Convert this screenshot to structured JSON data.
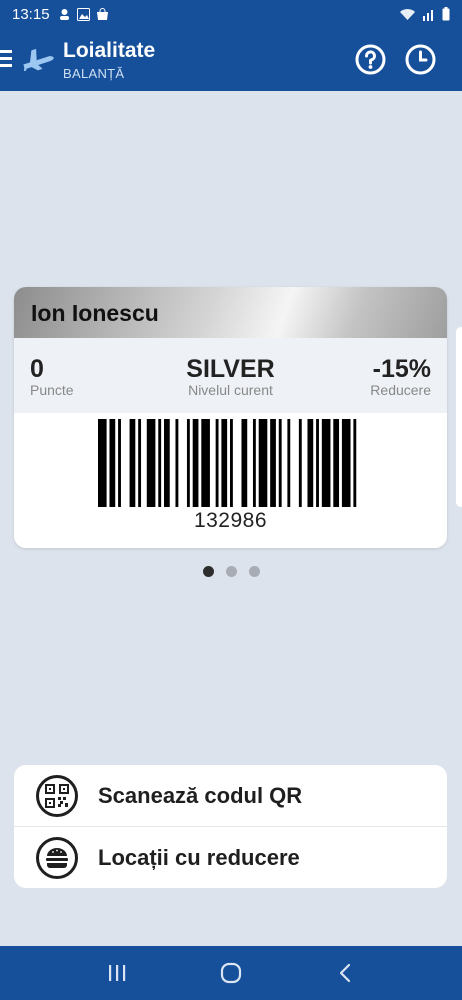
{
  "status_bar": {
    "time": "13:15"
  },
  "app_bar": {
    "title": "Loialitate",
    "subtitle": "BALANȚĂ",
    "icons": [
      "menu-icon",
      "plane-icon",
      "help-icon",
      "history-icon"
    ]
  },
  "card": {
    "holder": "Ion Ionescu",
    "points_value": "0",
    "points_label": "Puncte",
    "level_value": "SILVER",
    "level_label": "Nivelul curent",
    "discount_value": "-15%",
    "discount_label": "Reducere",
    "barcode_number": "132986"
  },
  "pager": {
    "count": 3,
    "active": 0
  },
  "actions": [
    {
      "label": "Scanează codul QR",
      "icon": "qr-code-icon"
    },
    {
      "label": "Locații cu reducere",
      "icon": "burger-icon"
    }
  ],
  "nav": {
    "icons": [
      "recent-apps-icon",
      "home-icon",
      "back-icon"
    ]
  },
  "colors": {
    "primary": "#164f9a",
    "background": "#dde3ec",
    "card_stats_bg": "#eef1f6"
  }
}
